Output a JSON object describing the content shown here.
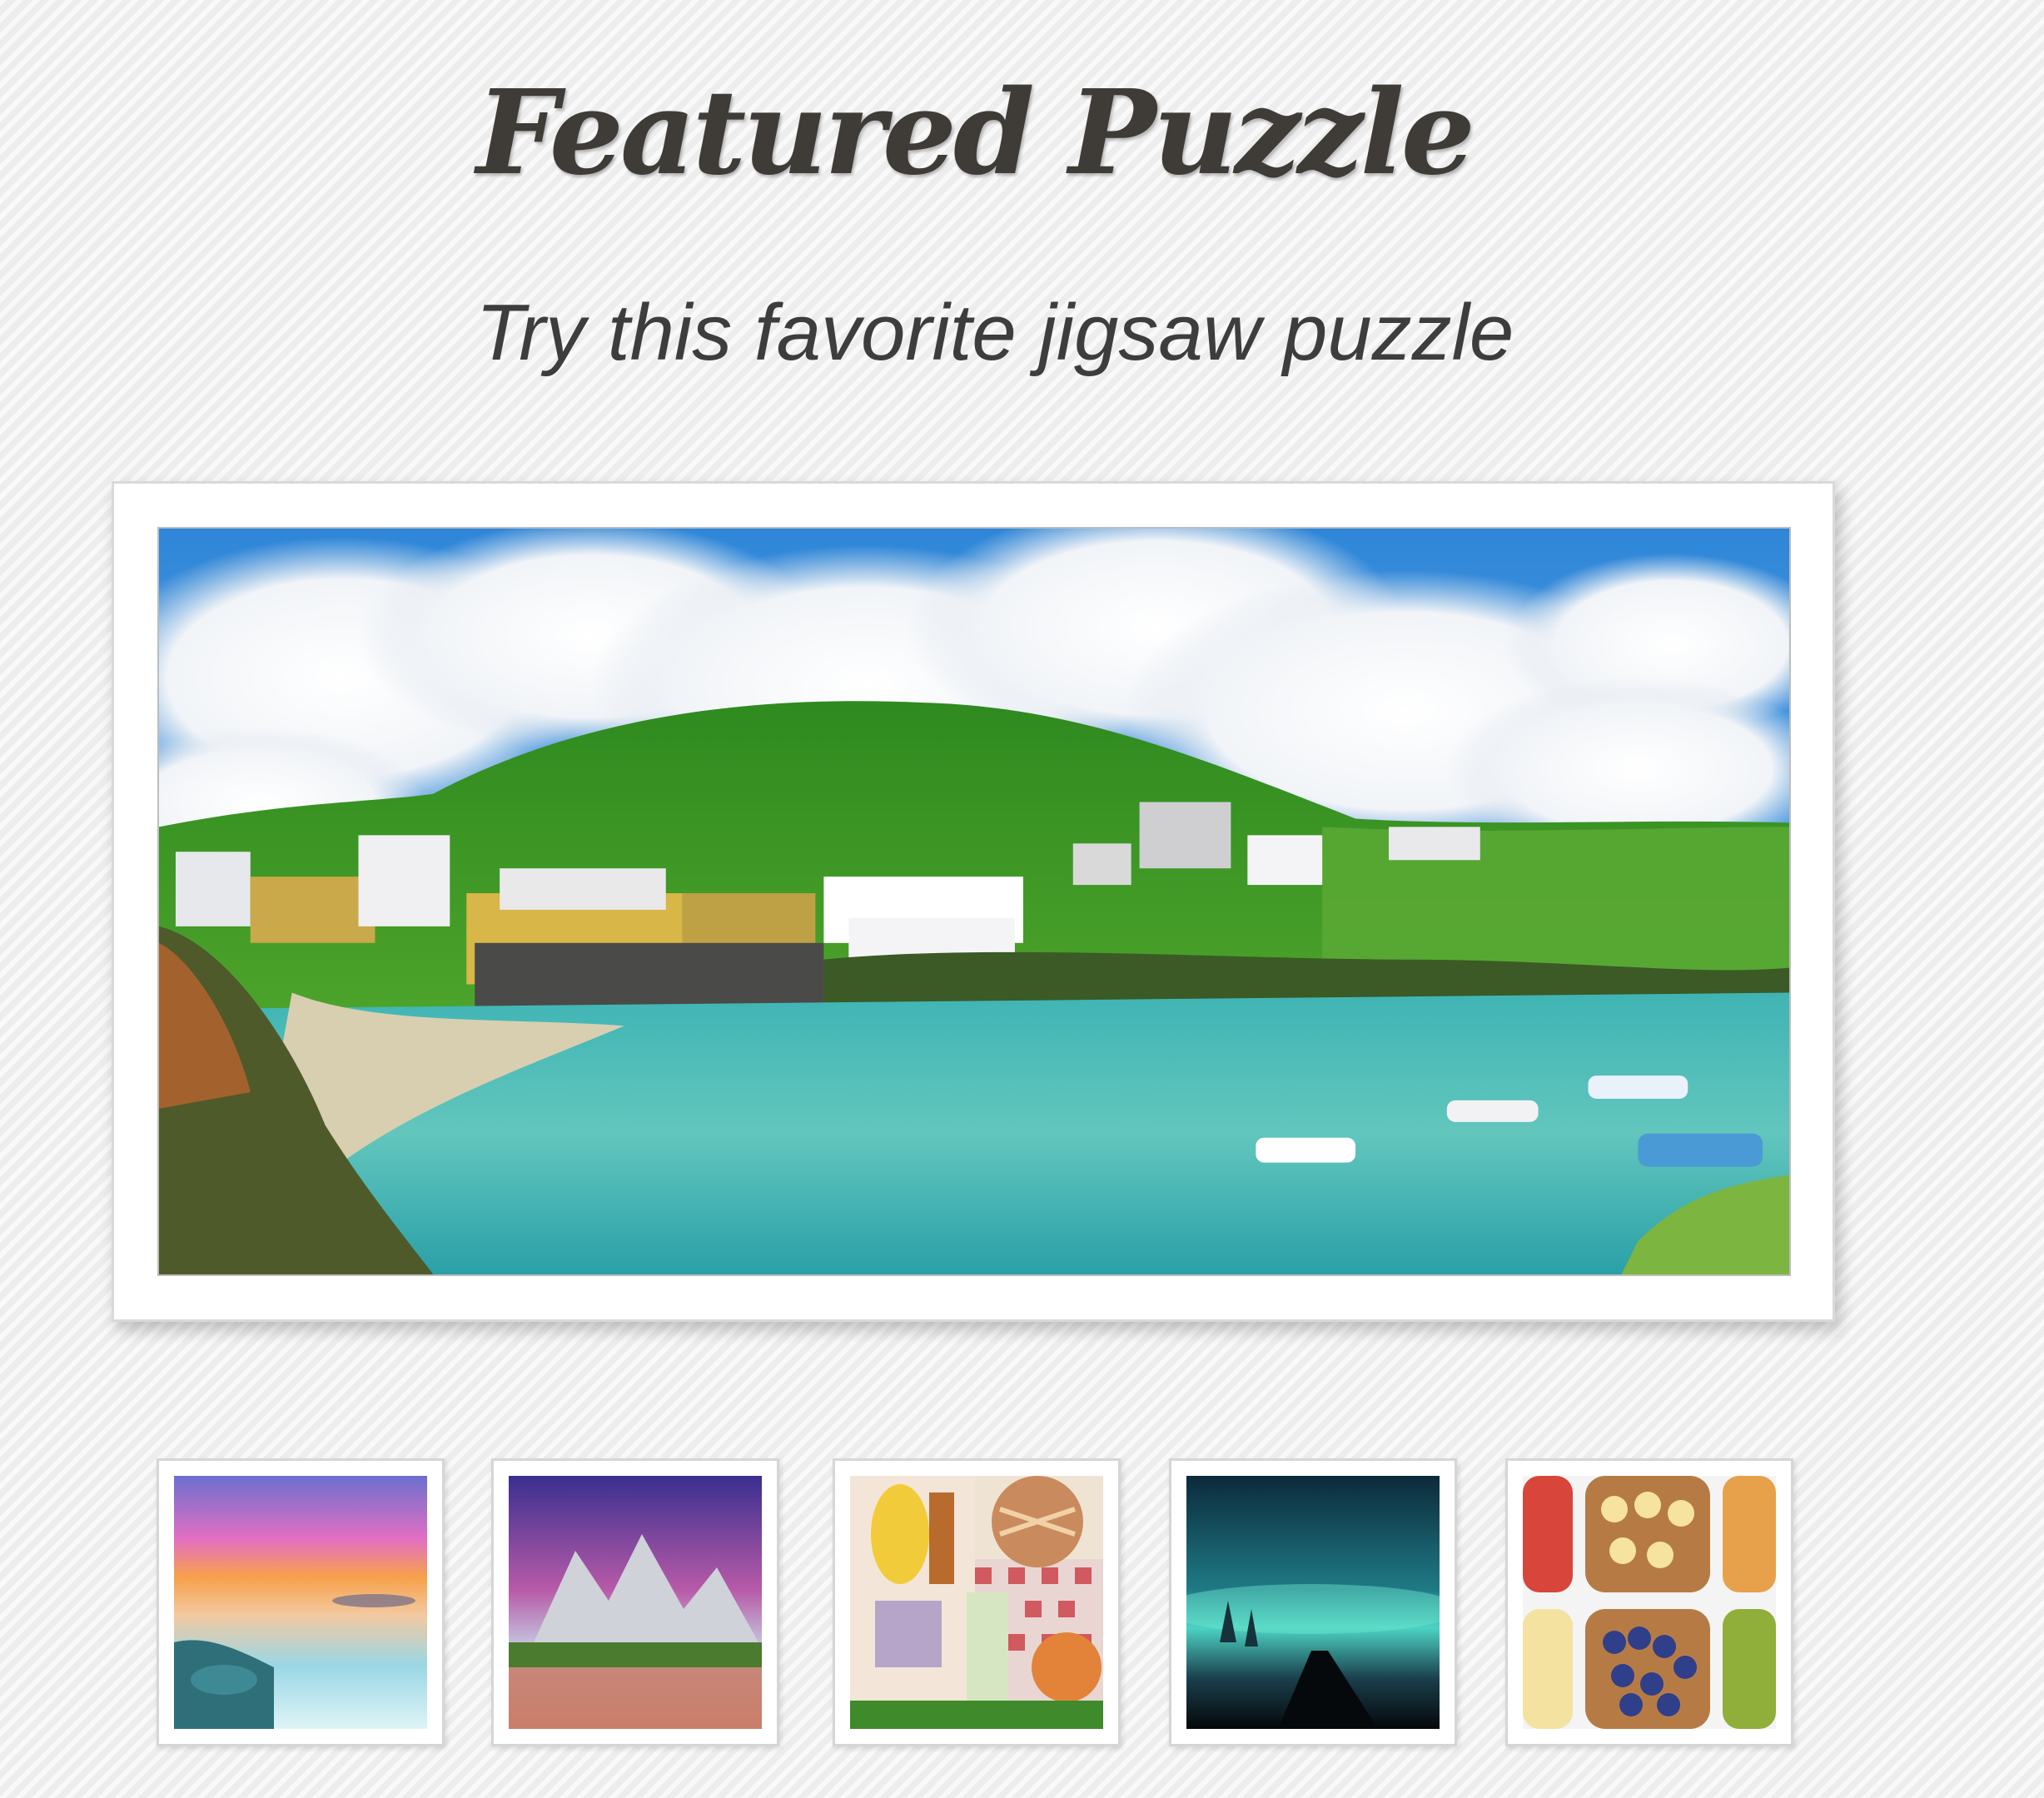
{
  "header": {
    "title": "Featured Puzzle",
    "subtitle": "Try this favorite jigsaw puzzle"
  },
  "featured": {
    "image_subject": "coastal-harbor-village-photo"
  },
  "thumbnails": [
    {
      "image_subject": "sunset-beach-photo"
    },
    {
      "image_subject": "mountain-lake-photo"
    },
    {
      "image_subject": "picnic-food-photo"
    },
    {
      "image_subject": "northern-lights-road-photo"
    },
    {
      "image_subject": "toast-toppings-photo"
    }
  ]
}
